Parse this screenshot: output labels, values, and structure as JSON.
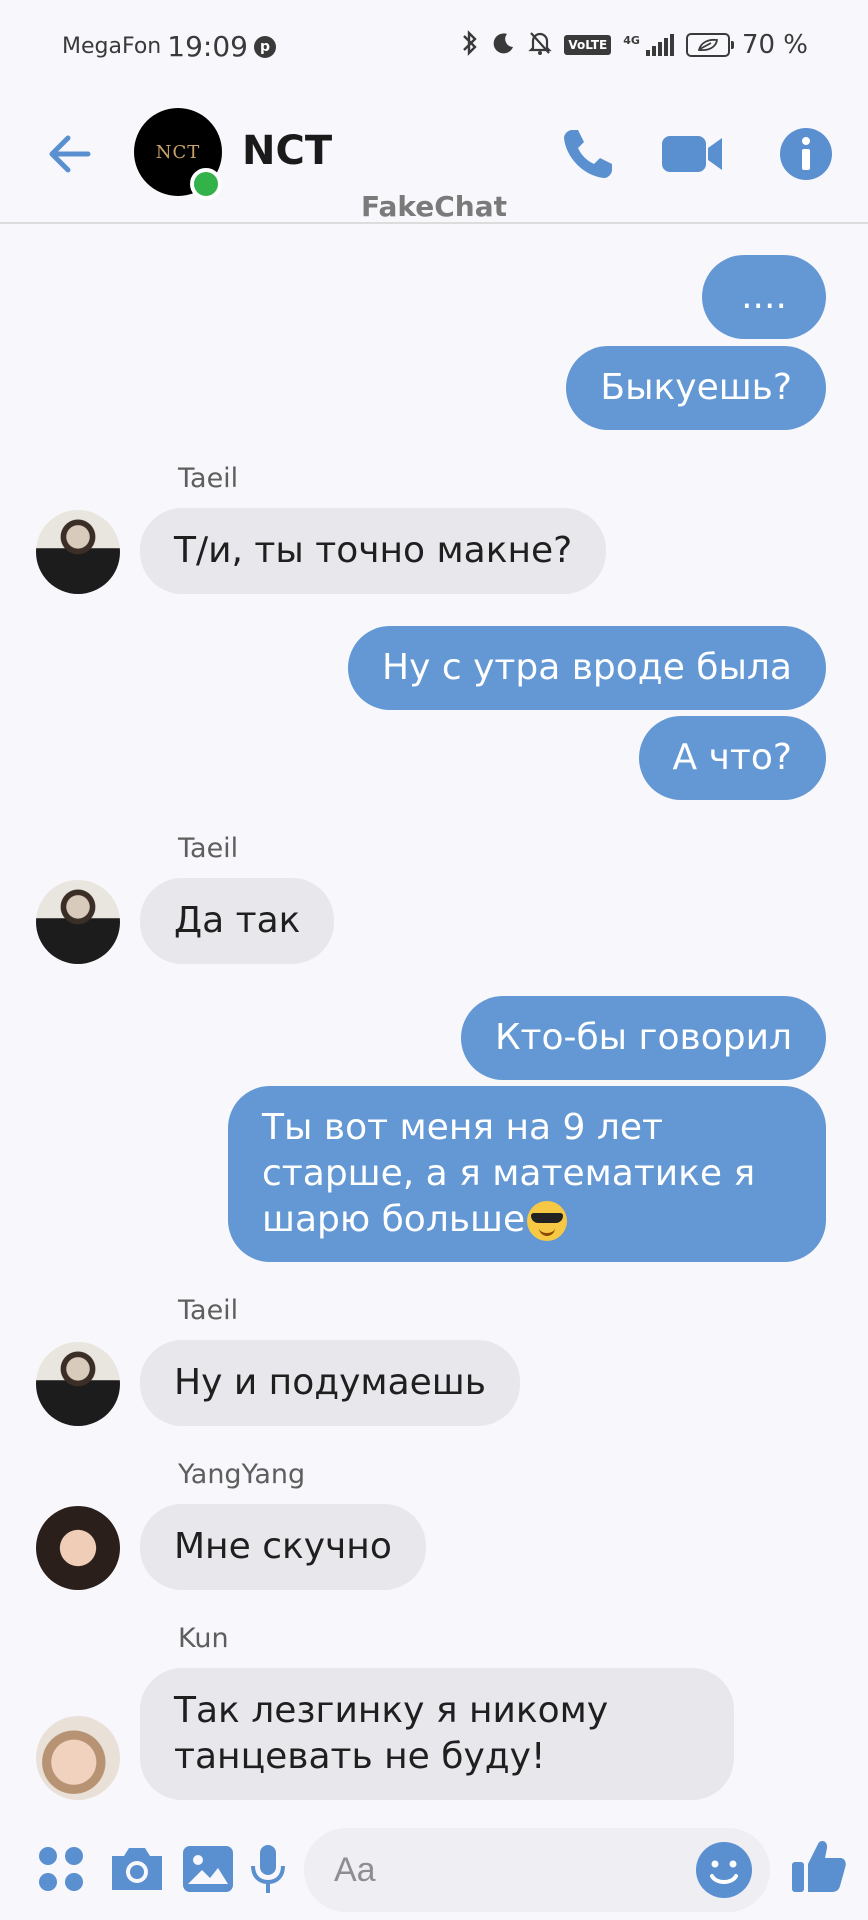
{
  "status_bar": {
    "carrier": "MegaFon",
    "time": "19:09",
    "volte": "VoLTE",
    "network": "4G",
    "battery_percent": "70 %"
  },
  "header": {
    "title": "NCT",
    "avatar_logo": "NCT",
    "watermark": "FakeChat",
    "icons": [
      "back-arrow-icon",
      "phone-icon",
      "video-camera-icon",
      "info-icon"
    ],
    "accent_color": "#5a8fd0"
  },
  "messages": [
    {
      "direction": "out",
      "text": "...."
    },
    {
      "direction": "out",
      "text": "Быкуешь?"
    },
    {
      "direction": "in",
      "sender": "Taeil",
      "text": "Т/и, ты точно макне?"
    },
    {
      "direction": "out",
      "text": "Ну с утра вроде была"
    },
    {
      "direction": "out",
      "text": "А что?"
    },
    {
      "direction": "in",
      "sender": "Taeil",
      "text": "Да так"
    },
    {
      "direction": "out",
      "text": "Кто-бы говорил"
    },
    {
      "direction": "out",
      "lines": [
        "Ты вот меня на 9 лет",
        "старше, а я математике я",
        "шарю больше"
      ],
      "emoji": "sunglasses-emoji"
    },
    {
      "direction": "in",
      "sender": "Taeil",
      "text": "Ну и подумаешь"
    },
    {
      "direction": "in",
      "sender": "YangYang",
      "text": "Мне скучно"
    },
    {
      "direction": "in",
      "sender": "Kun",
      "lines": [
        "Так лезгинку я никому",
        "танцевать не буду!"
      ]
    }
  ],
  "composer": {
    "placeholder": "Aa",
    "icons": [
      "apps-grid-icon",
      "camera-icon",
      "gallery-icon",
      "microphone-icon",
      "emoji-icon",
      "thumbs-up-icon"
    ]
  },
  "colors": {
    "outgoing_bubble": "#6398d4",
    "incoming_bubble": "#e8e7ec",
    "online": "#33b249"
  }
}
